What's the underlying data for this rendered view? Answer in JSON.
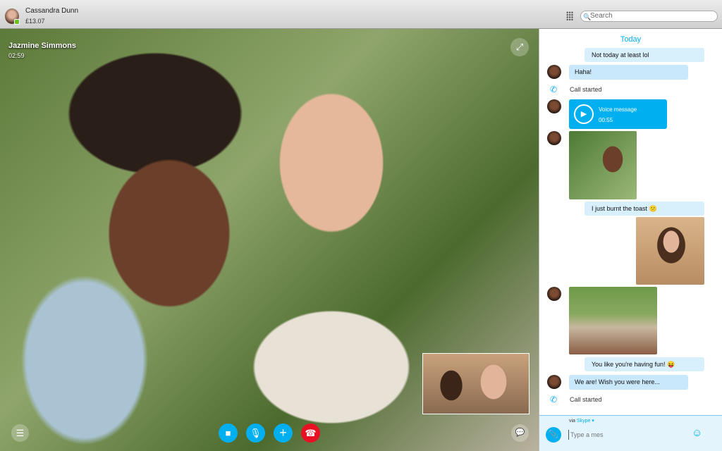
{
  "titlebar": {
    "user_name": "Cassandra Dunn",
    "credit": "£13.07",
    "search_placeholder": "Search"
  },
  "call": {
    "contact": "Jazmine Simmons",
    "duration": "02:59"
  },
  "colors": {
    "accent": "#00aff0",
    "end_call": "#e81123",
    "presence": "#6cc221"
  },
  "chat": {
    "date_label": "Today",
    "messages": [
      {
        "type": "outgoing",
        "text": "Not today at least lol"
      },
      {
        "type": "incoming",
        "text": "Haha!"
      },
      {
        "type": "system",
        "text": "Call started"
      },
      {
        "type": "voice",
        "label": "Voice message",
        "duration": "00:55"
      },
      {
        "type": "incoming-image"
      },
      {
        "type": "outgoing",
        "text": "I just burnt the toast 😕"
      },
      {
        "type": "outgoing-image"
      },
      {
        "type": "incoming-image"
      },
      {
        "type": "outgoing",
        "text": "You like you're having fun! 😝"
      },
      {
        "type": "incoming",
        "text": "We are! Wish you were here..."
      },
      {
        "type": "system",
        "text": "Call started"
      }
    ],
    "via": "via",
    "via_service": "Skype ▾",
    "input_placeholder": "Type a mes"
  }
}
